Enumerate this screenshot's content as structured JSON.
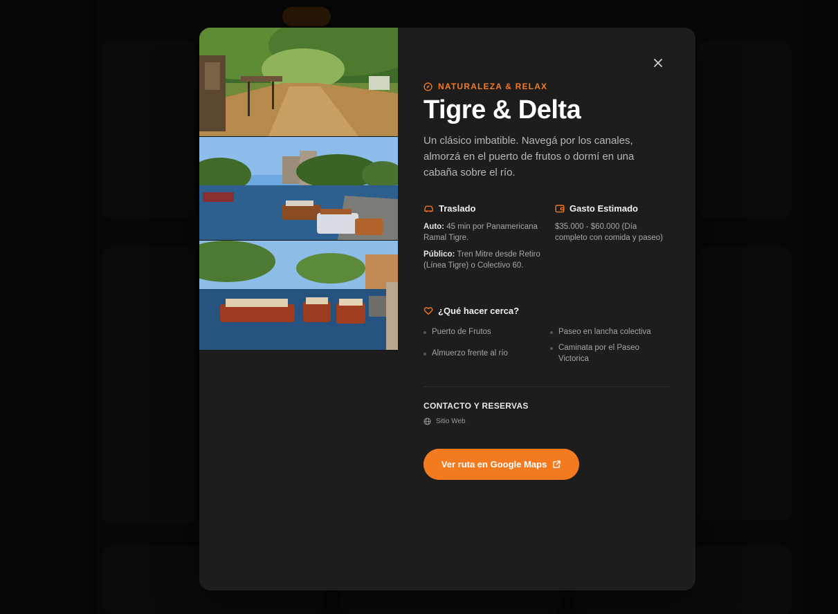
{
  "colors": {
    "accent": "#f47a1f",
    "modal_bg": "#1d1d1d",
    "page_bg": "#0b0b0b"
  },
  "modal": {
    "close_icon": "close-icon",
    "category": {
      "icon": "compass-icon",
      "label": "NATURALEZA & RELAX"
    },
    "title": "Tigre & Delta",
    "description": "Un clásico imbatible. Navegá por los canales, almorzá en el puerto de frutos o dormí en una cabaña sobre el río.",
    "transport": {
      "icon": "car-icon",
      "heading": "Traslado",
      "auto_label": "Auto:",
      "auto_text": " 45 min por Panamericana Ramal Tigre.",
      "public_label": "Público:",
      "public_text": " Tren Mitre desde Retiro (Línea Tigre) o Colectivo 60."
    },
    "budget": {
      "icon": "wallet-icon",
      "heading": "Gasto Estimado",
      "text": "$35.000 - $60.000 (Día completo con comida y paseo)"
    },
    "nearby": {
      "icon": "heart-icon",
      "heading": "¿Qué hacer cerca?",
      "items": [
        "Puerto de Frutos",
        "Paseo en lancha colectiva",
        "Almuerzo frente al río",
        "Caminata por el Paseo Victorica"
      ]
    },
    "contact": {
      "heading": "CONTACTO Y RESERVAS",
      "website_icon": "globe-icon",
      "website_label": "Sitio Web"
    },
    "maps_button": {
      "label": "Ver ruta en Google Maps",
      "icon": "external-link-icon"
    },
    "gallery": [
      "tigre-canal-photo",
      "tigre-harbor-photo",
      "tigre-boats-photo"
    ]
  }
}
